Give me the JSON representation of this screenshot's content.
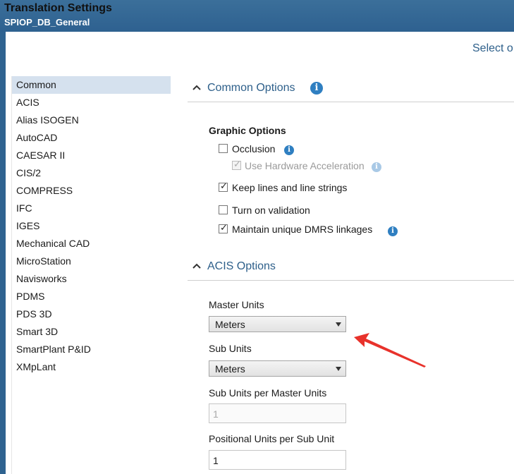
{
  "window": {
    "title": "Translation Settings",
    "subtitle": "SPIOP_DB_General"
  },
  "header": {
    "select_partial": "Select o"
  },
  "sidebar": {
    "items": [
      {
        "label": "Common",
        "selected": true
      },
      {
        "label": "ACIS"
      },
      {
        "label": "Alias ISOGEN"
      },
      {
        "label": "AutoCAD"
      },
      {
        "label": "CAESAR II"
      },
      {
        "label": "CIS/2"
      },
      {
        "label": "COMPRESS"
      },
      {
        "label": "IFC"
      },
      {
        "label": "IGES"
      },
      {
        "label": "Mechanical CAD"
      },
      {
        "label": "MicroStation"
      },
      {
        "label": "Navisworks"
      },
      {
        "label": "PDMS"
      },
      {
        "label": "PDS 3D"
      },
      {
        "label": "Smart 3D"
      },
      {
        "label": "SmartPlant P&ID"
      },
      {
        "label": "XMpLant"
      }
    ]
  },
  "common_options": {
    "title": "Common Options",
    "graphic_options_label": "Graphic Options",
    "occlusion": {
      "label": "Occlusion",
      "checked": false
    },
    "use_hw_accel": {
      "label": "Use Hardware Acceleration",
      "checked": true,
      "enabled": false
    },
    "keep_lines": {
      "label": "Keep lines and line strings",
      "checked": true
    },
    "turn_on_validation": {
      "label": "Turn on validation",
      "checked": false
    },
    "maintain_dmrs": {
      "label": "Maintain unique DMRS linkages",
      "checked": true
    }
  },
  "acis_options": {
    "title": "ACIS Options",
    "master_units": {
      "label": "Master Units",
      "value": "Meters"
    },
    "sub_units": {
      "label": "Sub Units",
      "value": "Meters"
    },
    "sub_per_master": {
      "label": "Sub Units per Master Units",
      "value": "1",
      "enabled": false
    },
    "positional_per_sub": {
      "label": "Positional Units per Sub Unit",
      "value": "1"
    }
  },
  "colors": {
    "accent": "#2d5f8a",
    "titlebar": "#2f6390",
    "selection": "#d5e1ee",
    "info_icon": "#2f7fc1",
    "annotation_arrow": "#e8322b"
  },
  "icons": [
    "info-icon",
    "chevron-up-icon",
    "dropdown-arrow-icon",
    "checkbox-checked-icon"
  ]
}
